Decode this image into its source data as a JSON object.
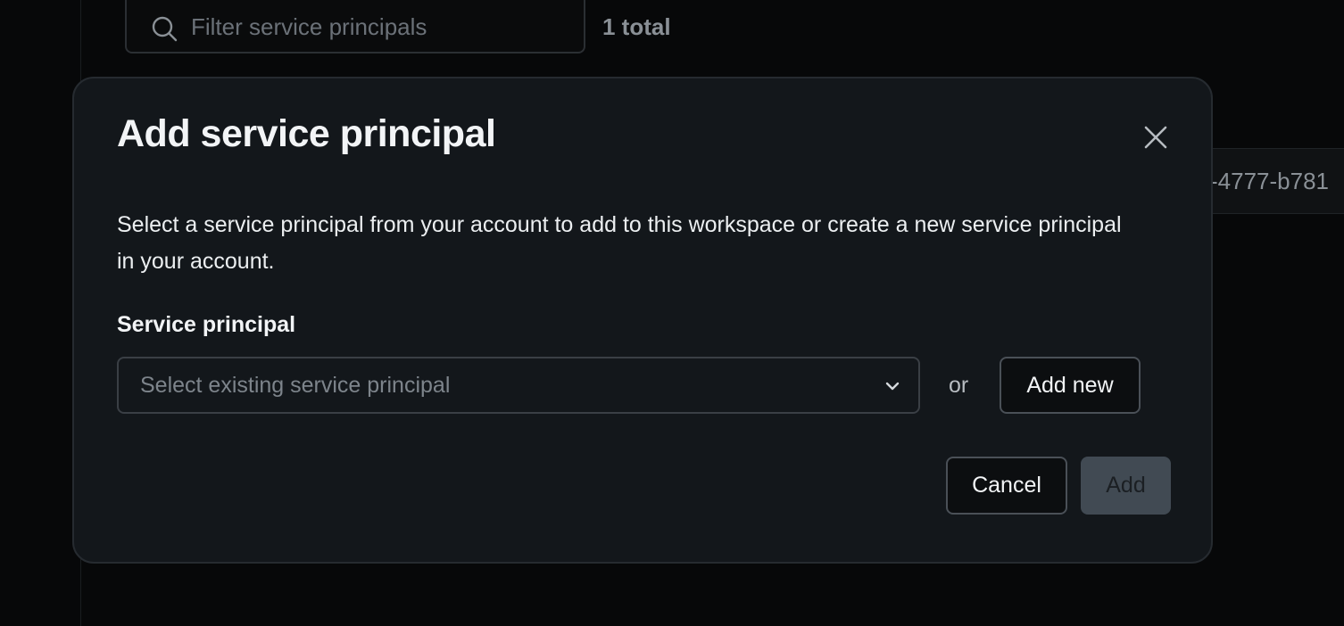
{
  "background": {
    "filter": {
      "placeholder": "Filter service principals",
      "icon": "search-icon"
    },
    "total_count": "1 total",
    "row_fragment": "-4777-b781"
  },
  "modal": {
    "title": "Add service principal",
    "close_icon": "close-icon",
    "description": "Select a service principal from your account to add to this workspace or create a new service principal in your account.",
    "field_label": "Service principal",
    "select": {
      "placeholder": "Select existing service principal",
      "icon": "chevron-down-icon"
    },
    "or_label": "or",
    "add_new_label": "Add new",
    "cancel_label": "Cancel",
    "add_label": "Add"
  },
  "colors": {
    "page_background": "#070809",
    "modal_background": "#13171b",
    "disabled_button": "#414a53"
  }
}
